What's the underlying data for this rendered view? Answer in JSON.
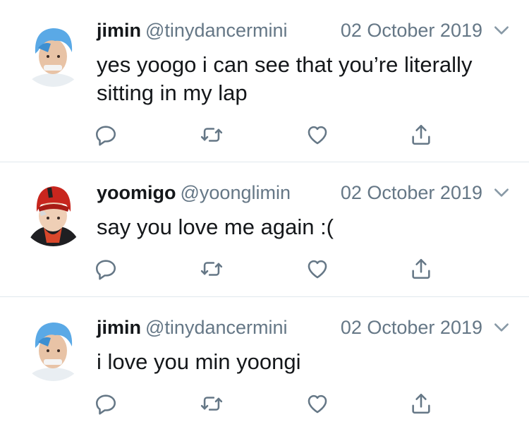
{
  "tweets": [
    {
      "name": "jimin",
      "handle": "@tinydancermini",
      "date": "02 October 2019",
      "text": "yes yoogo i can see that you’re literally sitting in my lap",
      "avatar": "avatar-blue-hair"
    },
    {
      "name": "yoomigo",
      "handle": "@yoonglimin",
      "date": "02 October 2019",
      "text": "say you love me again :(",
      "avatar": "avatar-red-beanie"
    },
    {
      "name": "jimin",
      "handle": "@tinydancermini",
      "date": "02 October 2019",
      "text": "i love you min yoongi",
      "avatar": "avatar-blue-hair"
    }
  ],
  "icons": {
    "reply": "reply-icon",
    "retweet": "retweet-icon",
    "like": "like-icon",
    "share": "share-icon",
    "caret": "chevron-down-icon"
  },
  "colors": {
    "name": "#14171a",
    "meta": "#657786",
    "divider": "#e1e8ed",
    "hair_blue": "#5aa9e6",
    "beanie_red": "#c8261e"
  }
}
